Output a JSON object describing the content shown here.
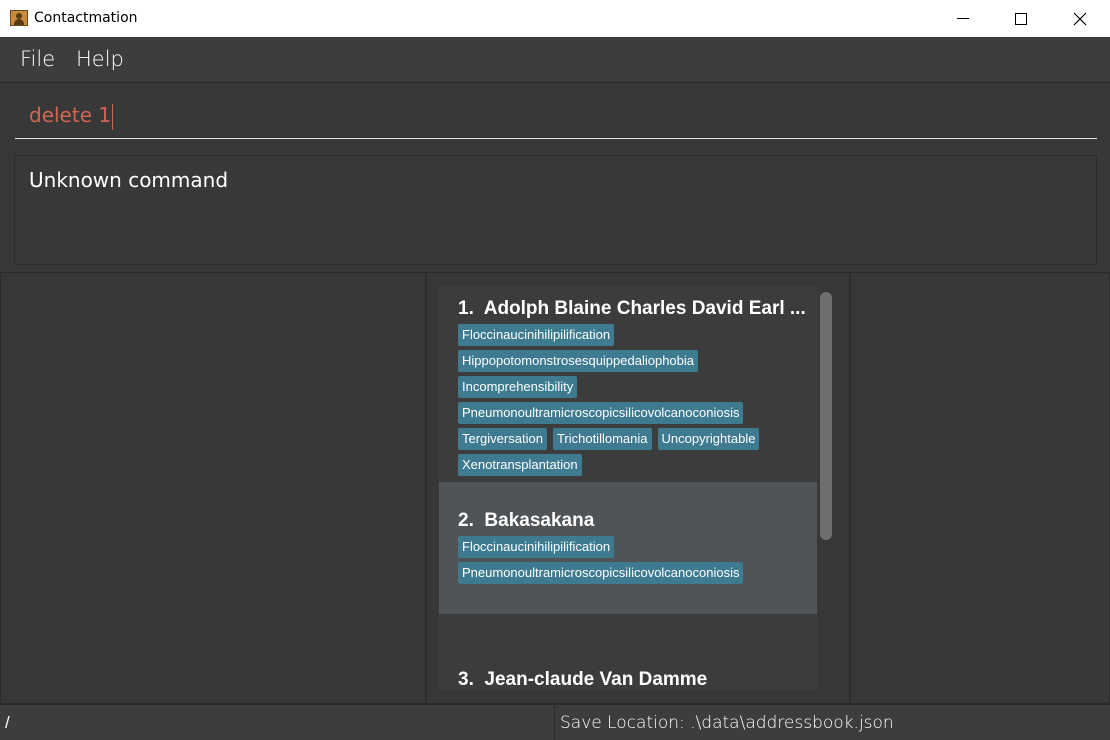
{
  "window": {
    "title": "Contactmation",
    "icon": "contact-book-icon"
  },
  "menu": {
    "file_label": "File",
    "help_label": "Help"
  },
  "command": {
    "value": "delete 1"
  },
  "result": {
    "message": "Unknown command"
  },
  "persons": [
    {
      "index": "1.",
      "name": "Adolph Blaine Charles David Earl ...",
      "tags": [
        "Floccinaucinihilipilification",
        "Hippopotomonstrosesquippedaliophobia",
        "Incomprehensibility",
        "Pneumonoultramicroscopicsilicovolcanoconiosis",
        "Tergiversation",
        "Trichotillomania",
        "Uncopyrightable",
        "Xenotransplantation"
      ]
    },
    {
      "index": "2.",
      "name": "Bakasakana",
      "tags": [
        "Floccinaucinihilipilification",
        "Pneumonoultramicroscopicsilicovolcanoconiosis"
      ]
    },
    {
      "index": "3.",
      "name": "Jean-claude Van Damme",
      "tags": []
    }
  ],
  "status": {
    "path": "/",
    "save_location": "Save Location: .\\data\\addressbook.json"
  },
  "colors": {
    "background": "#383838",
    "tag": "#3e7b91",
    "selected_card": "#505456",
    "command_text": "#d06651"
  }
}
